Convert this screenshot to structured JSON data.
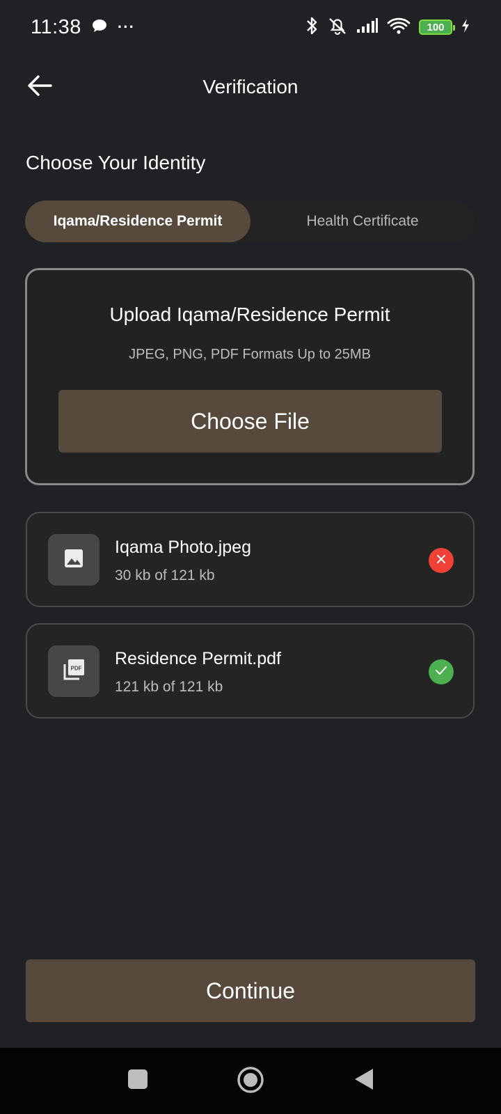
{
  "status_bar": {
    "time": "11:38",
    "more": "···",
    "battery": "100"
  },
  "header": {
    "title": "Verification"
  },
  "identity": {
    "title": "Choose Your Identity",
    "tabs": [
      {
        "label": "Iqama/Residence Permit",
        "active": true
      },
      {
        "label": "Health Certificate",
        "active": false
      }
    ]
  },
  "upload": {
    "title": "Upload Iqama/Residence Permit",
    "subtitle": "JPEG, PNG, PDF Formats Up to 25MB",
    "button_label": "Choose File"
  },
  "files": [
    {
      "name": "Iqama Photo.jpeg",
      "size": "30 kb of 121 kb",
      "icon": "image-icon",
      "status": "error",
      "status_icon": "close-icon",
      "status_color": "#ef4135"
    },
    {
      "name": "Residence Permit.pdf",
      "size": "121 kb of 121 kb",
      "icon": "pdf-icon",
      "status": "success",
      "status_icon": "check-icon",
      "status_color": "#4caf50"
    }
  ],
  "footer": {
    "continue_label": "Continue"
  },
  "colors": {
    "background": "#202125",
    "accent": "#57493c",
    "error": "#ef4135",
    "success": "#4caf50"
  }
}
